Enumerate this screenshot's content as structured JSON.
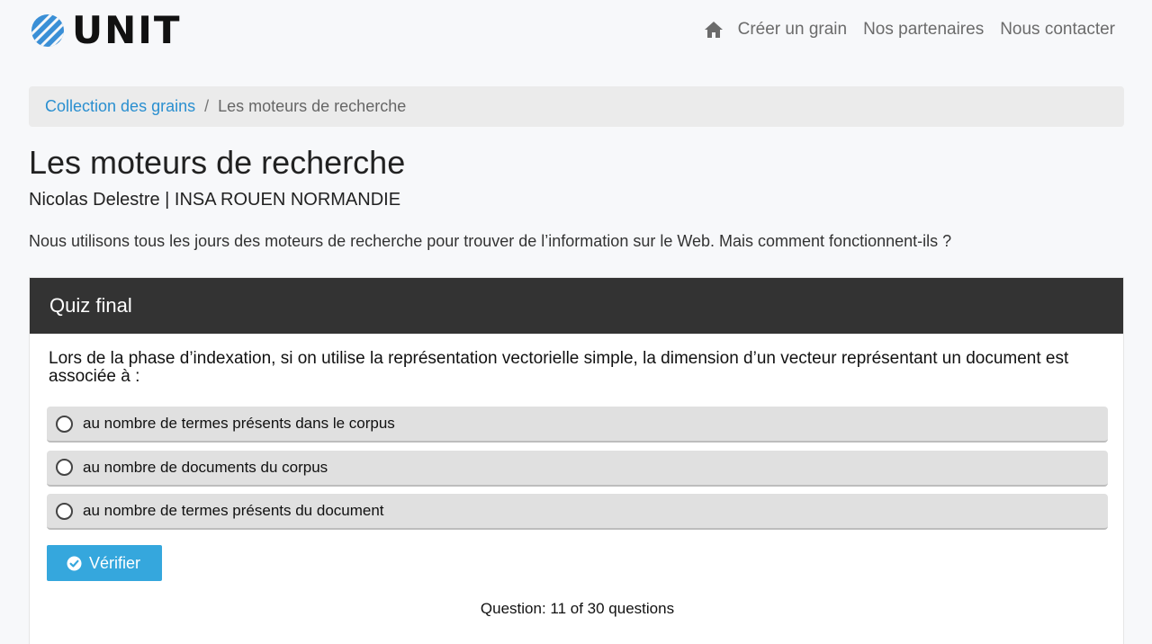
{
  "header": {
    "logo_text": "UNIT",
    "nav": {
      "home_icon": "home-icon",
      "items": [
        "Créer un grain",
        "Nos partenaires",
        "Nous contacter"
      ]
    }
  },
  "breadcrumb": {
    "link": "Collection des grains",
    "separator": "/",
    "current": "Les moteurs de recherche"
  },
  "page": {
    "title": "Les moteurs de recherche",
    "author": "Nicolas Delestre | INSA ROUEN NORMANDIE",
    "description": "Nous utilisons tous les jours des moteurs de recherche pour trouver de l’information sur le Web. Mais comment fonctionnent-ils ?"
  },
  "quiz": {
    "header": "Quiz final",
    "question": "Lors de la phase d’indexation, si on utilise la représentation vectorielle simple, la dimension d’un vecteur représentant un document est associée à :",
    "options": [
      "au nombre de termes présents dans le corpus",
      "au nombre de documents du corpus",
      "au nombre de termes présents du document"
    ],
    "verify_label": "Vérifier",
    "verify_icon": "check-circle-icon",
    "progress": "Question: 11 of 30 questions"
  },
  "colors": {
    "accent": "#35a7dd",
    "link": "#2a8fd0",
    "quiz_header_bg": "#333333",
    "option_bg": "#e0e0e0"
  }
}
